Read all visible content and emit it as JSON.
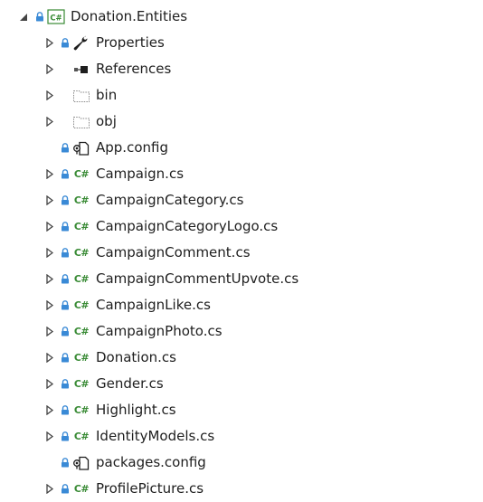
{
  "solution_explorer": {
    "project": {
      "label": "Donation.Entities",
      "badge": "C#",
      "expanded": true
    },
    "items": [
      {
        "label": "Properties",
        "expandable": true,
        "icon": "wrench-icon",
        "source_controlled": true
      },
      {
        "label": "References",
        "expandable": true,
        "icon": "references-icon",
        "source_controlled": false
      },
      {
        "label": "bin",
        "expandable": true,
        "icon": "folder-outline-icon",
        "source_controlled": false
      },
      {
        "label": "obj",
        "expandable": true,
        "icon": "folder-outline-icon",
        "source_controlled": false
      },
      {
        "label": "App.config",
        "expandable": false,
        "icon": "config-file-icon",
        "source_controlled": true
      },
      {
        "label": "Campaign.cs",
        "expandable": true,
        "icon": "csharp-file-icon",
        "source_controlled": true
      },
      {
        "label": "CampaignCategory.cs",
        "expandable": true,
        "icon": "csharp-file-icon",
        "source_controlled": true
      },
      {
        "label": "CampaignCategoryLogo.cs",
        "expandable": true,
        "icon": "csharp-file-icon",
        "source_controlled": true
      },
      {
        "label": "CampaignComment.cs",
        "expandable": true,
        "icon": "csharp-file-icon",
        "source_controlled": true
      },
      {
        "label": "CampaignCommentUpvote.cs",
        "expandable": true,
        "icon": "csharp-file-icon",
        "source_controlled": true
      },
      {
        "label": "CampaignLike.cs",
        "expandable": true,
        "icon": "csharp-file-icon",
        "source_controlled": true
      },
      {
        "label": "CampaignPhoto.cs",
        "expandable": true,
        "icon": "csharp-file-icon",
        "source_controlled": true
      },
      {
        "label": "Donation.cs",
        "expandable": true,
        "icon": "csharp-file-icon",
        "source_controlled": true
      },
      {
        "label": "Gender.cs",
        "expandable": true,
        "icon": "csharp-file-icon",
        "source_controlled": true
      },
      {
        "label": "Highlight.cs",
        "expandable": true,
        "icon": "csharp-file-icon",
        "source_controlled": true
      },
      {
        "label": "IdentityModels.cs",
        "expandable": true,
        "icon": "csharp-file-icon",
        "source_controlled": true
      },
      {
        "label": "packages.config",
        "expandable": false,
        "icon": "config-file-icon",
        "source_controlled": true
      },
      {
        "label": "ProfilePicture.cs",
        "expandable": true,
        "icon": "csharp-file-icon",
        "source_controlled": true
      }
    ],
    "csharp_badge": "C#",
    "colors": {
      "lock": "#3a8ad6",
      "csharp": "#388a34",
      "text": "#1e1e1e",
      "caret": "#444444"
    }
  }
}
